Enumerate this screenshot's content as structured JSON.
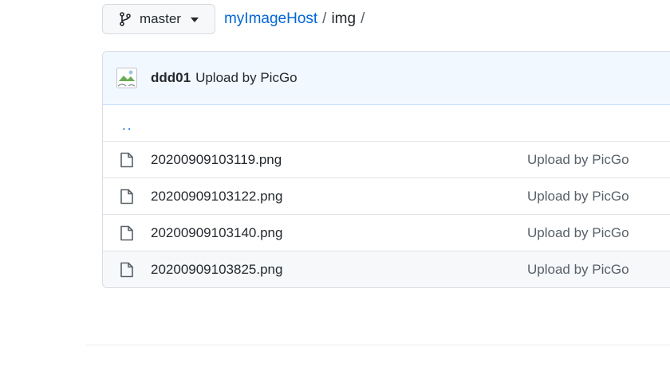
{
  "branch": {
    "name": "master",
    "icon": "git-branch-icon"
  },
  "breadcrumb": {
    "repo": "myImageHost",
    "separator": "/",
    "dir": "img",
    "trailing_separator": "/"
  },
  "commit": {
    "author": "ddd01",
    "message": "Upload by PicGo",
    "avatar_icon": "broken-image-icon"
  },
  "parent_dir_link": "..",
  "files": [
    {
      "name": "20200909103119.png",
      "commit_message": "Upload by PicGo",
      "icon": "file-icon"
    },
    {
      "name": "20200909103122.png",
      "commit_message": "Upload by PicGo",
      "icon": "file-icon"
    },
    {
      "name": "20200909103140.png",
      "commit_message": "Upload by PicGo",
      "icon": "file-icon"
    },
    {
      "name": "20200909103825.png",
      "commit_message": "Upload by PicGo",
      "icon": "file-icon"
    }
  ],
  "colors": {
    "link": "#0366d6",
    "commit_bar_bg": "#f1f8ff",
    "muted_text": "#586069"
  }
}
